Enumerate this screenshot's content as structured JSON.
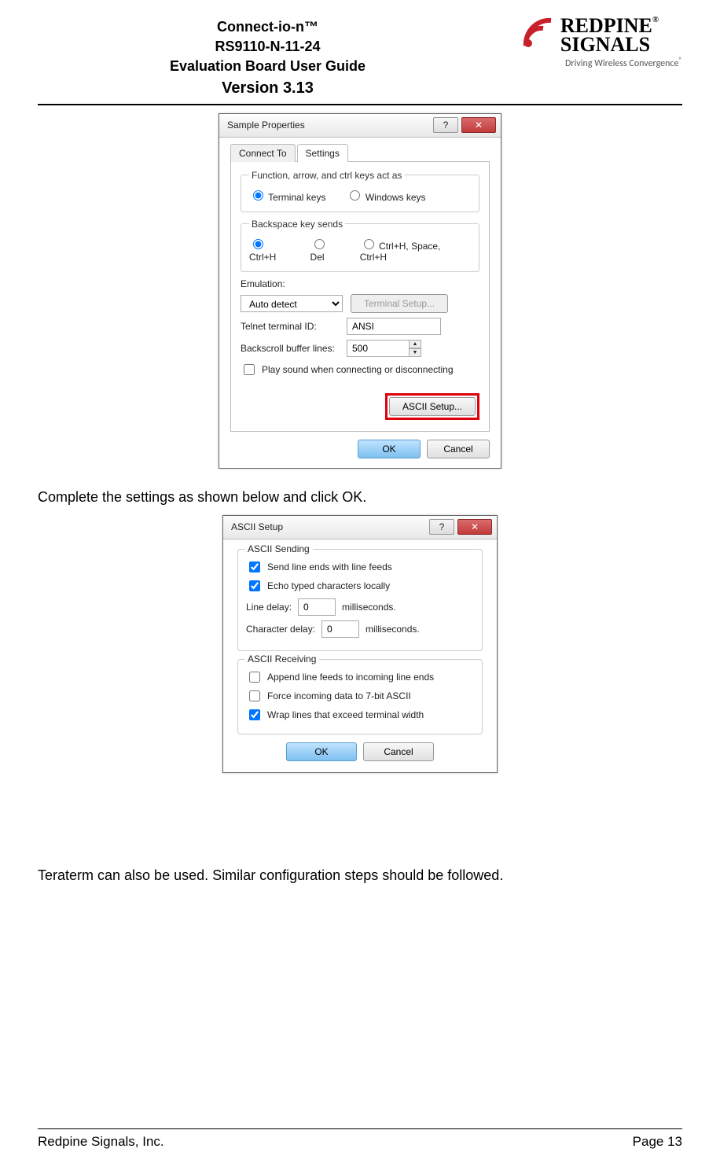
{
  "header": {
    "line1": "Connect-io-n™",
    "line2": "RS9110-N-11-24",
    "line3": "Evaluation Board User Guide",
    "line4": "Version 3.13",
    "logo_top": "REDPINE",
    "logo_bottom": "SIGNALS",
    "tagline": "Driving Wireless Convergence"
  },
  "dialog1": {
    "title": "Sample Properties",
    "tabs": {
      "connect": "Connect To",
      "settings": "Settings"
    },
    "group1_legend": "Function, arrow, and ctrl keys act as",
    "g1_opt1": "Terminal keys",
    "g1_opt2": "Windows keys",
    "group2_legend": "Backspace key sends",
    "g2_opt1": "Ctrl+H",
    "g2_opt2": "Del",
    "g2_opt3": "Ctrl+H, Space, Ctrl+H",
    "emulation_label": "Emulation:",
    "emulation_value": "Auto detect",
    "terminal_setup": "Terminal Setup...",
    "telnet_label": "Telnet terminal ID:",
    "telnet_value": "ANSI",
    "backscroll_label": "Backscroll buffer lines:",
    "backscroll_value": "500",
    "play_sound": "Play sound when connecting or disconnecting",
    "ascii_setup": "ASCII Setup...",
    "ok": "OK",
    "cancel": "Cancel"
  },
  "midtext": "Complete the settings as shown below and click OK.",
  "dialog2": {
    "title": "ASCII Setup",
    "sending_title": "ASCII Sending",
    "send_line_ends": "Send line ends with line feeds",
    "echo_typed": "Echo typed characters locally",
    "line_delay_label": "Line delay:",
    "line_delay_value": "0",
    "ms": "milliseconds.",
    "char_delay_label": "Character delay:",
    "char_delay_value": "0",
    "receiving_title": "ASCII Receiving",
    "append_lf": "Append line feeds to incoming line ends",
    "force_7bit": "Force incoming data to 7-bit ASCII",
    "wrap_lines": "Wrap lines that exceed terminal width",
    "ok": "OK",
    "cancel": "Cancel"
  },
  "bottom_text": "Teraterm can also be used. Similar configuration steps should be followed.",
  "footer": {
    "left": "Redpine Signals, Inc.",
    "right": "Page 13"
  }
}
